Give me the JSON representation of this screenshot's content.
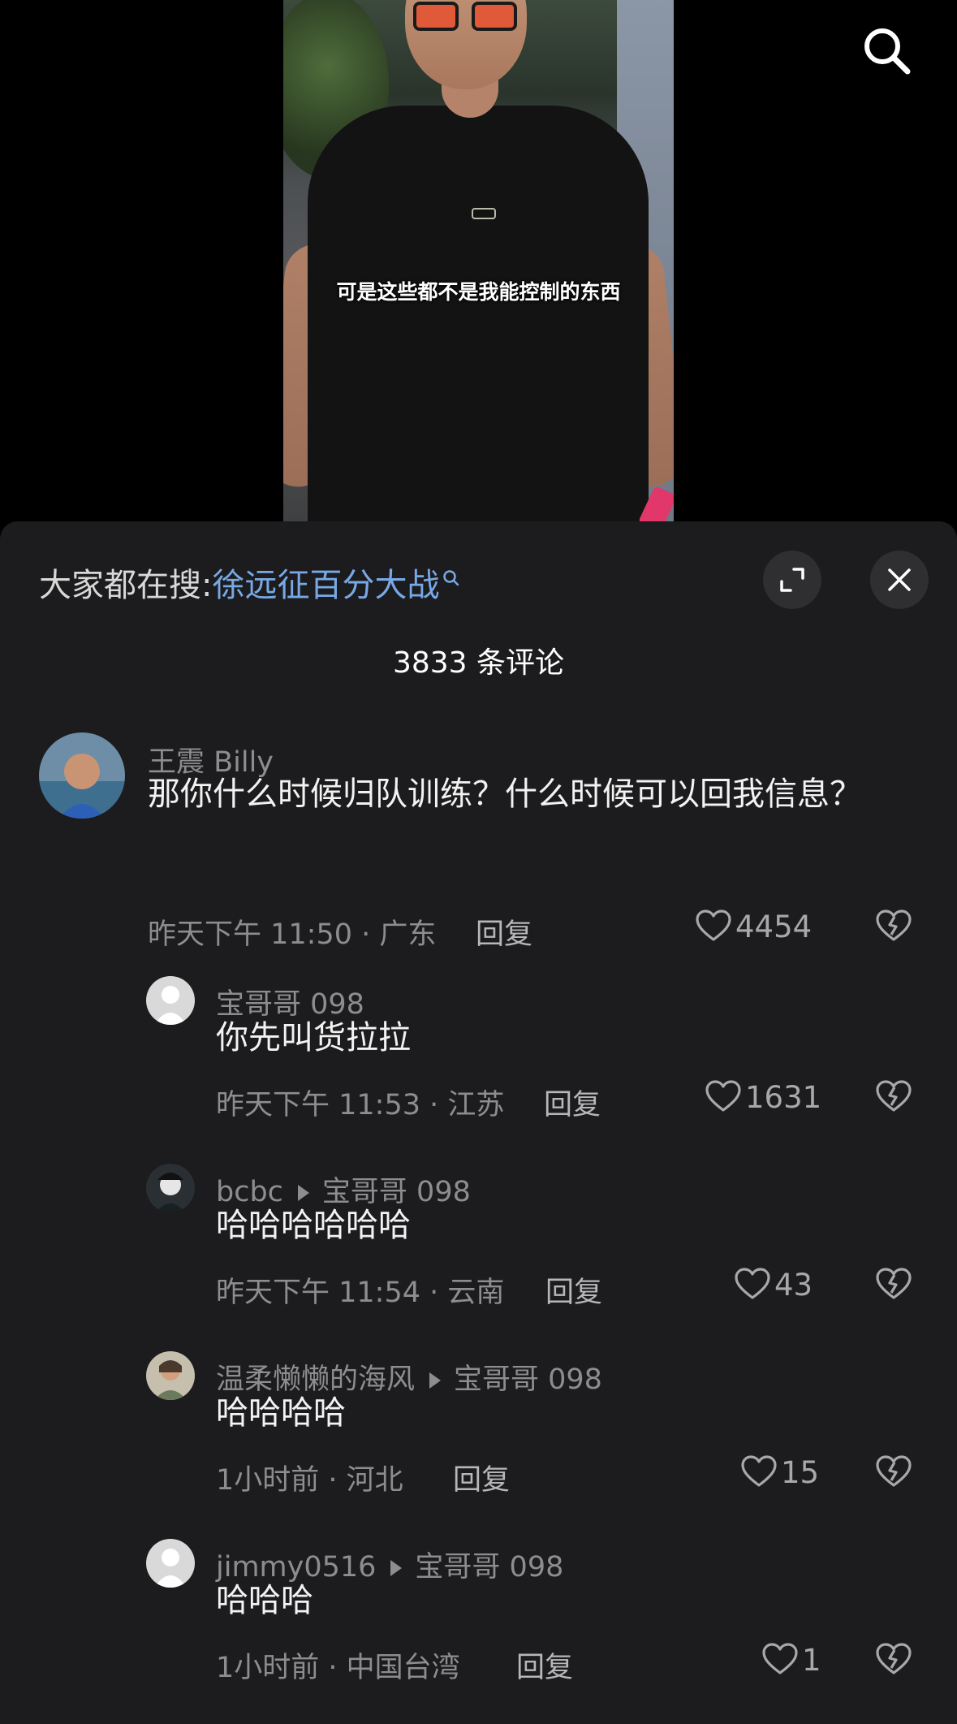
{
  "video": {
    "subtitle": "可是这些都不是我能控制的东西"
  },
  "comments_panel": {
    "hot_search_prefix": "大家都在搜:",
    "hot_search_keyword": "徐远征百分大战",
    "count_label": "3833 条评论",
    "reply_label": "回复",
    "comments": [
      {
        "author": "王震 Billy",
        "text": "那你什么时候归队训练？什么时候可以回我信息？",
        "time": "昨天下午 11:50",
        "location": "广东",
        "likes": "4454"
      },
      {
        "author": "宝哥哥 098",
        "text": "你先叫货拉拉",
        "time": "昨天下午 11:53",
        "location": "江苏",
        "likes": "1631"
      },
      {
        "author": "bcbc",
        "reply_to": "宝哥哥 098",
        "text": "哈哈哈哈哈哈",
        "time": "昨天下午 11:54",
        "location": "云南",
        "likes": "43"
      },
      {
        "author": "温柔懒懒的海风",
        "reply_to": "宝哥哥 098",
        "text": "哈哈哈哈",
        "time": "1小时前",
        "location": "河北",
        "likes": "15"
      },
      {
        "author": "jimmy0516",
        "reply_to": "宝哥哥 098",
        "text": "哈哈哈",
        "time": "1小时前",
        "location": "中国台湾",
        "likes": "1"
      }
    ]
  },
  "icons": [
    "search-icon",
    "expand-icon",
    "close-icon",
    "heart-icon",
    "broken-heart-icon"
  ],
  "colors": {
    "sheet_bg": "#1c1c1e",
    "keyword": "#78a9e6",
    "secondary_text": "#8d8d8f"
  }
}
